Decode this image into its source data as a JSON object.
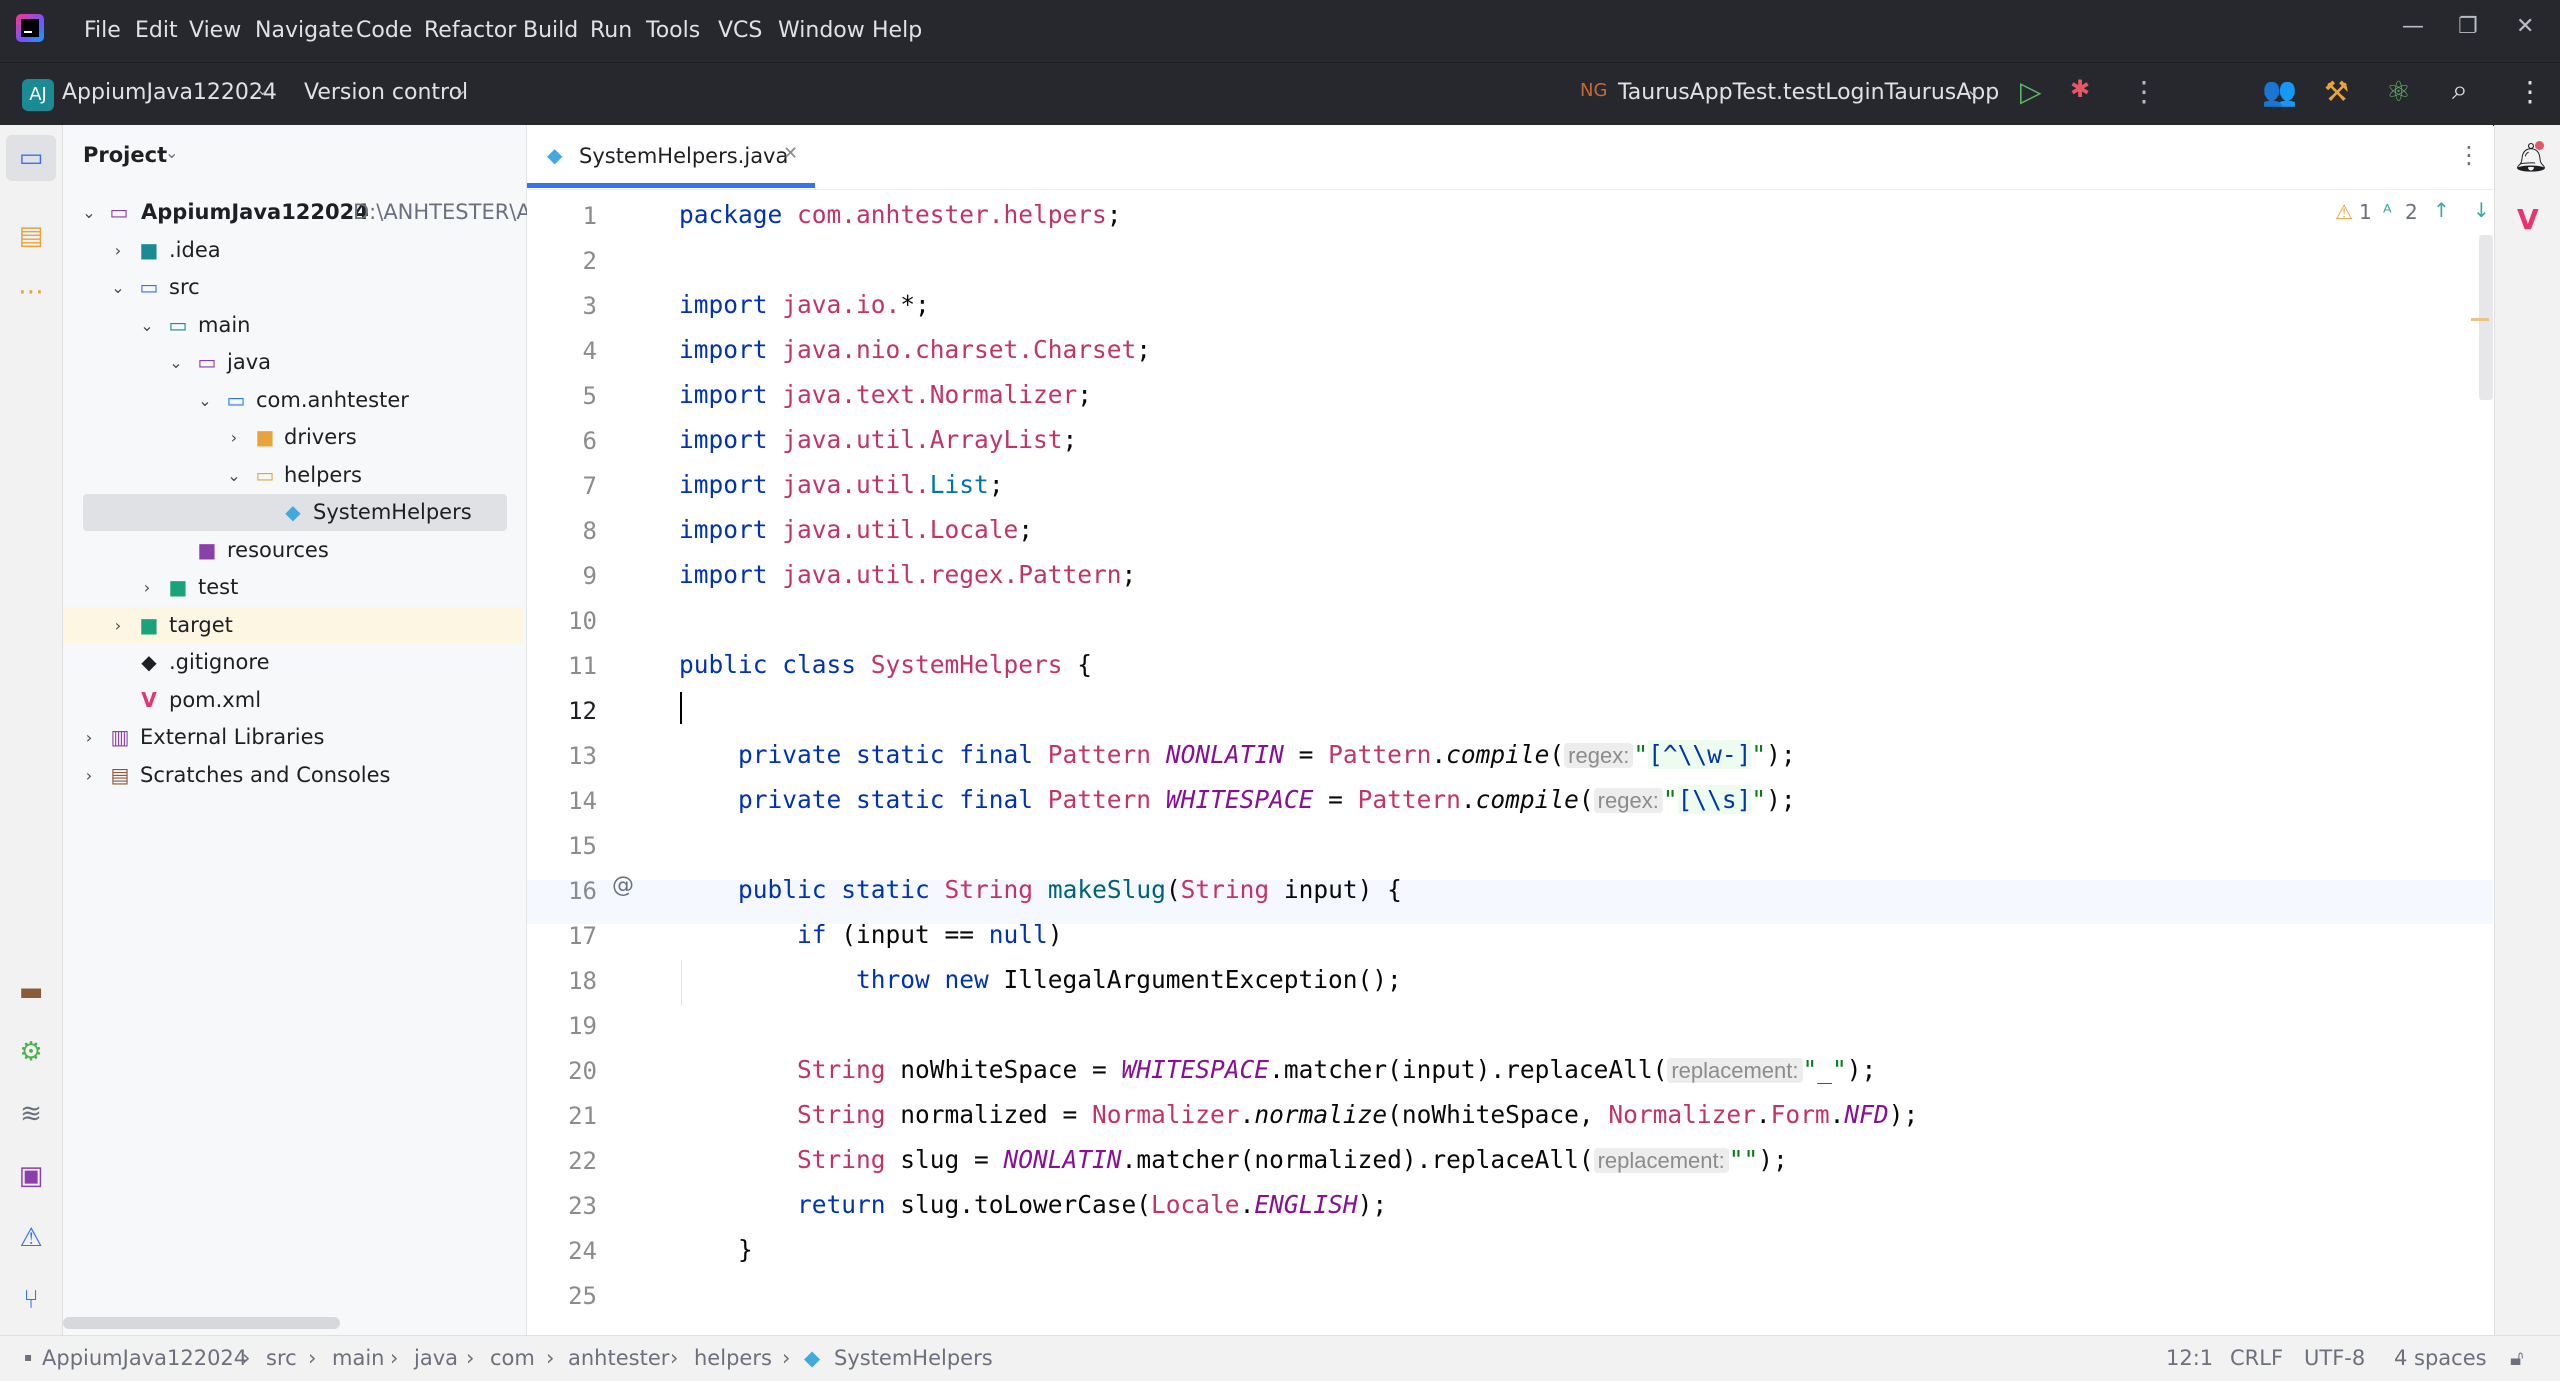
{
  "menu": {
    "items": [
      "File",
      "Edit",
      "View",
      "Navigate",
      "Code",
      "Refactor",
      "Build",
      "Run",
      "Tools",
      "VCS",
      "Window",
      "Help"
    ]
  },
  "toolbar": {
    "project_badge": "AJ",
    "project_name": "AppiumJava122024",
    "vcs": "Version control",
    "run_config": "TaurusAppTest.testLoginTaurusApp"
  },
  "project_panel": {
    "title": "Project",
    "root_name": "AppiumJava122024",
    "root_path": "D:\\ANHTESTER\\Ap",
    "nodes": {
      "idea": ".idea",
      "src": "src",
      "main": "main",
      "java": "java",
      "pkg": "com.anhtester",
      "drivers": "drivers",
      "helpers": "helpers",
      "systemhelpers": "SystemHelpers",
      "resources": "resources",
      "test": "test",
      "target": "target",
      "gitignore": ".gitignore",
      "pom": "pom.xml",
      "extlibs": "External Libraries",
      "scratches": "Scratches and Consoles"
    }
  },
  "editor": {
    "tab": "SystemHelpers.java",
    "warnings": "1",
    "typos": "2",
    "line_numbers": [
      "1",
      "2",
      "3",
      "4",
      "5",
      "6",
      "7",
      "8",
      "9",
      "10",
      "11",
      "12",
      "13",
      "14",
      "15",
      "16",
      "17",
      "18",
      "19",
      "20",
      "21",
      "22",
      "23",
      "24",
      "25"
    ],
    "gutter_at": "@",
    "hints": {
      "regex": "regex:",
      "replacement": "replacement:"
    }
  },
  "statusbar": {
    "breadcrumbs": [
      "AppiumJava122024",
      "src",
      "main",
      "java",
      "com",
      "anhtester",
      "helpers",
      "SystemHelpers"
    ],
    "position": "12:1",
    "line_sep": "CRLF",
    "encoding": "UTF-8",
    "indent": "4 spaces"
  },
  "colors": {
    "dark_bar": "#27282e",
    "keyword": "#0033b3",
    "type": "#c23468",
    "string": "#067d17",
    "field": "#871094",
    "tab_underline": "#3574f0"
  }
}
